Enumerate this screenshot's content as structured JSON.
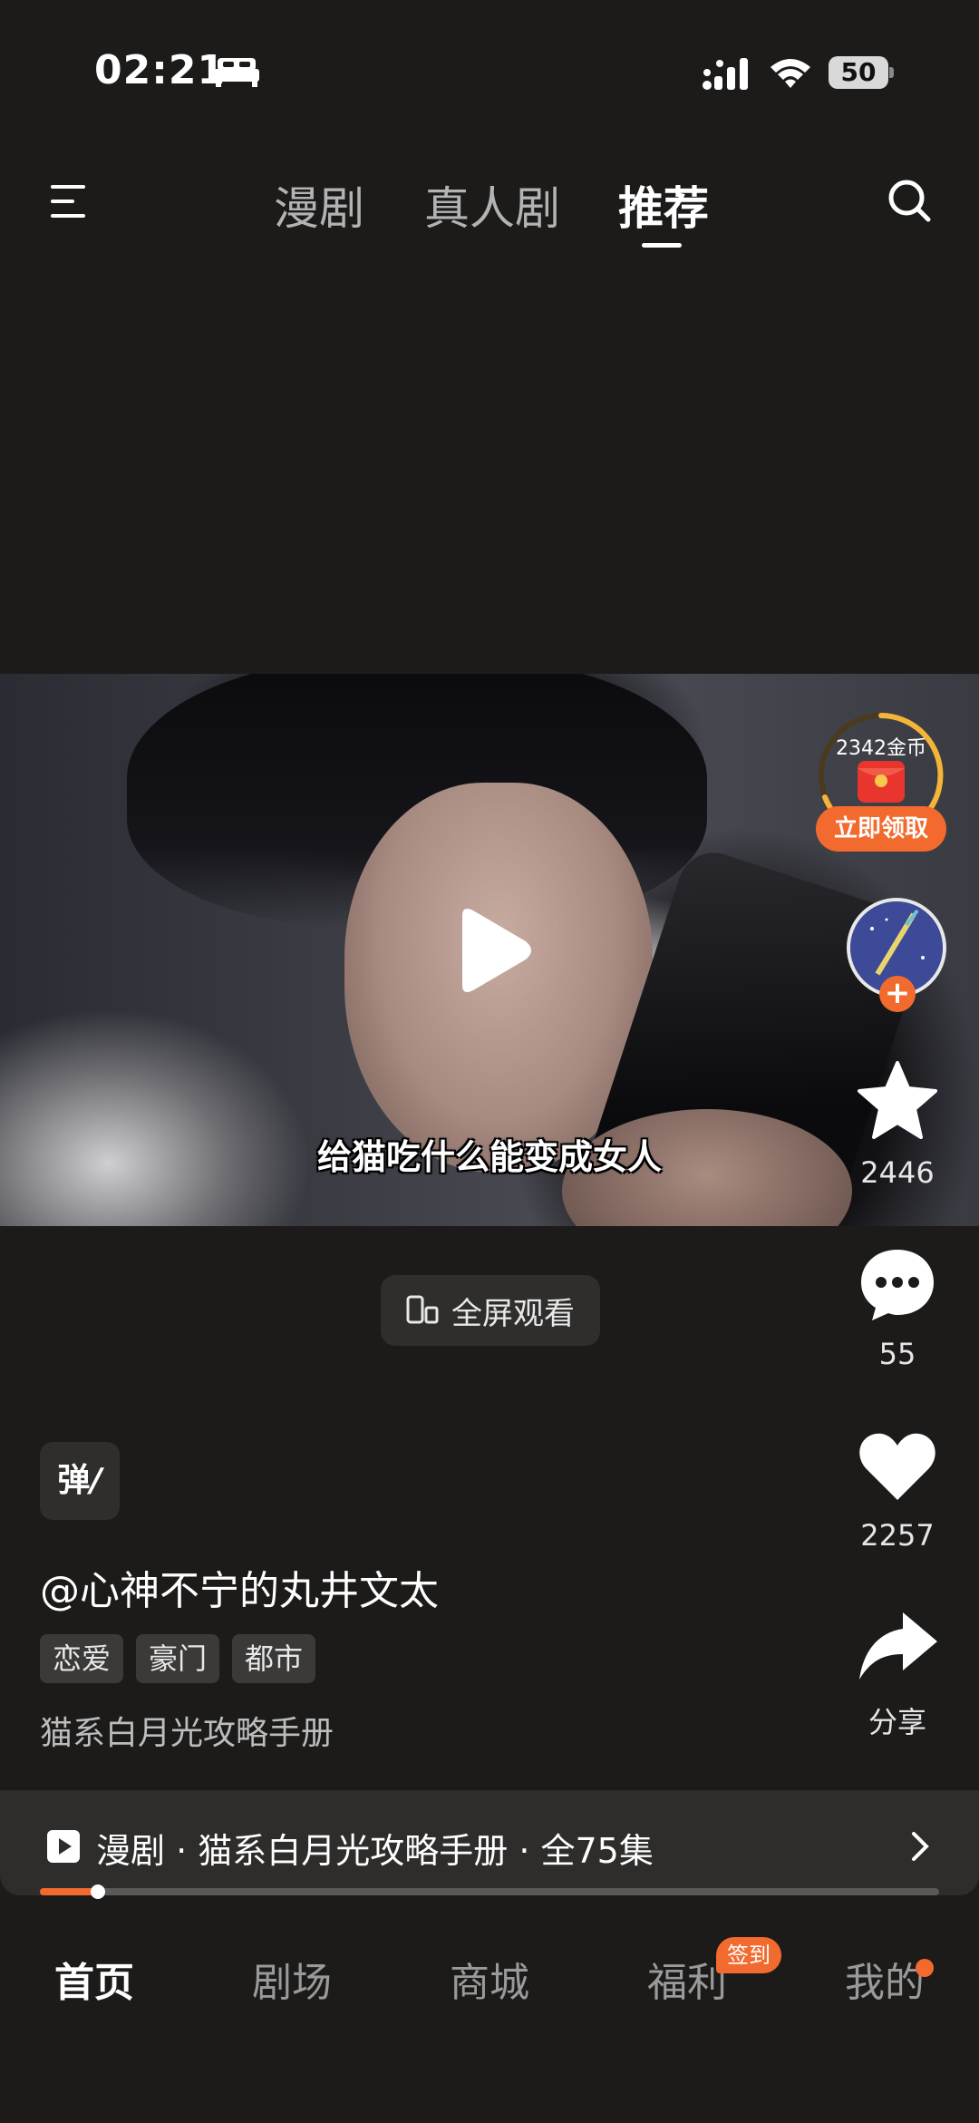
{
  "status_bar": {
    "time": "02:21",
    "battery": "50"
  },
  "top_tabs": [
    {
      "label": "漫剧"
    },
    {
      "label": "真人剧"
    },
    {
      "label": "推荐"
    }
  ],
  "video": {
    "subtitle": "给猫吃什么能变成女人"
  },
  "fullscreen_label": "全屏观看",
  "reward": {
    "coins": "2342金币",
    "claim_label": "立即领取"
  },
  "actions": {
    "favorite_count": "2446",
    "comment_count": "55",
    "like_count": "2257",
    "share_label": "分享"
  },
  "danmaku_label": "弹",
  "author": "@心神不宁的丸井文太",
  "tags": [
    "恋爱",
    "豪门",
    "都市"
  ],
  "description": "猫系白月光攻略手册",
  "series": {
    "text": "漫剧 · 猫系白月光攻略手册 · 全75集",
    "progress": 0.065
  },
  "bottom_nav": [
    {
      "label": "首页"
    },
    {
      "label": "剧场"
    },
    {
      "label": "商城"
    },
    {
      "label": "福利"
    },
    {
      "label": "我的"
    }
  ],
  "welfare_badge": "签到",
  "colors": {
    "accent": "#f26a2e",
    "background": "#1c1b1a"
  },
  "icons": [
    "bed-icon",
    "signal-icon",
    "wifi-icon",
    "menu-icon",
    "search-icon",
    "play-icon",
    "rotate-screen-icon",
    "red-envelope-icon",
    "star-icon",
    "comment-icon",
    "heart-icon",
    "share-icon",
    "chevron-right-icon"
  ]
}
